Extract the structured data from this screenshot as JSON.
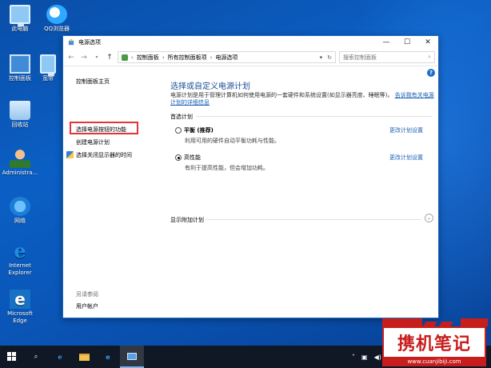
{
  "desktop": {
    "icons": [
      {
        "label": "此电脑",
        "icon": "this-pc-icon"
      },
      {
        "label": "QQ浏览器",
        "icon": "qq-browser-icon"
      },
      {
        "label": "控制面板",
        "icon": "control-panel-icon"
      },
      {
        "label": "宽带",
        "icon": "broadband-icon"
      },
      {
        "label": "回收站",
        "icon": "recycle-bin-icon"
      },
      {
        "label": "Administra...",
        "icon": "user-folder-icon"
      },
      {
        "label": "网络",
        "icon": "network-icon"
      },
      {
        "label": "Internet Explorer",
        "icon": "ie-icon"
      },
      {
        "label": "Microsoft Edge",
        "icon": "edge-icon"
      }
    ]
  },
  "window": {
    "title": "电源选项",
    "breadcrumbs": [
      "控制面板",
      "所有控制面板项",
      "电源选项"
    ],
    "search_placeholder": "搜索控制面板",
    "help_glyph": "?"
  },
  "sidebar": {
    "home": "控制面板主页",
    "items": [
      "选择电源按钮的功能",
      "创建电源计划",
      "选择关闭显示器的时间"
    ],
    "see_also_label": "另请参阅",
    "see_also_link": "用户帐户"
  },
  "main": {
    "title": "选择或自定义电源计划",
    "description": "电源计划是用于管理计算机如何使用电源的一套硬件和系统设置(如显示器亮度、睡眠等)。",
    "description_link": "告诉我有关电源计划的详细信息",
    "section_label": "首选计划",
    "plans": [
      {
        "name": "平衡 (推荐)",
        "desc": "利用可用的硬件自动平衡功耗与性能。",
        "change_label": "更改计划设置",
        "selected": false
      },
      {
        "name": "高性能",
        "desc": "有利于提高性能，但会增加功耗。",
        "change_label": "更改计划设置",
        "selected": true
      }
    ],
    "extra_label": "显示附加计划"
  },
  "watermark": {
    "text": "携机笔记",
    "url": "www.cuanjibiji.com"
  },
  "colors": {
    "title_blue": "#1c4e96",
    "link_blue": "#1a5fb4",
    "highlight_red": "#e23535",
    "taskbar": "#101826"
  }
}
